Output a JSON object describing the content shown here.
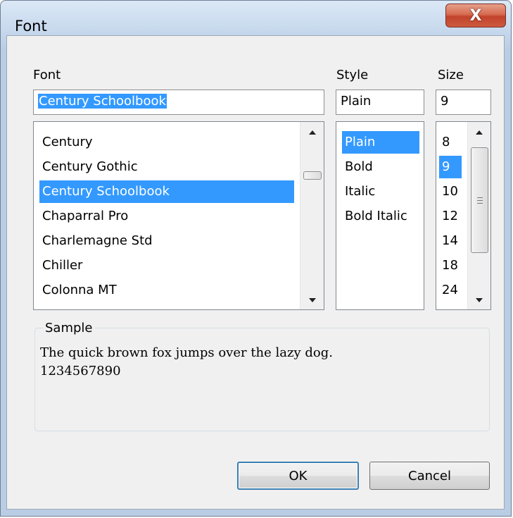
{
  "window": {
    "title": "Font",
    "close_glyph": "X"
  },
  "labels": {
    "font": "Font",
    "style": "Style",
    "size": "Size"
  },
  "inputs": {
    "font": "Century Schoolbook",
    "style": "Plain",
    "size": "9"
  },
  "lists": {
    "fonts": [
      "Century",
      "Century Gothic",
      "Century Schoolbook",
      "Chaparral Pro",
      "Charlemagne Std",
      "Chiller",
      "Colonna MT"
    ],
    "fonts_selected": "Century Schoolbook",
    "styles": [
      "Plain",
      "Bold",
      "Italic",
      "Bold Italic"
    ],
    "styles_selected": "Plain",
    "sizes": [
      "8",
      "9",
      "10",
      "12",
      "14",
      "18",
      "24"
    ],
    "sizes_selected": "9"
  },
  "sample": {
    "label": "Sample",
    "line1": "The quick brown fox jumps over the lazy dog.",
    "line2": "1234567890"
  },
  "buttons": {
    "ok": "OK",
    "cancel": "Cancel"
  }
}
